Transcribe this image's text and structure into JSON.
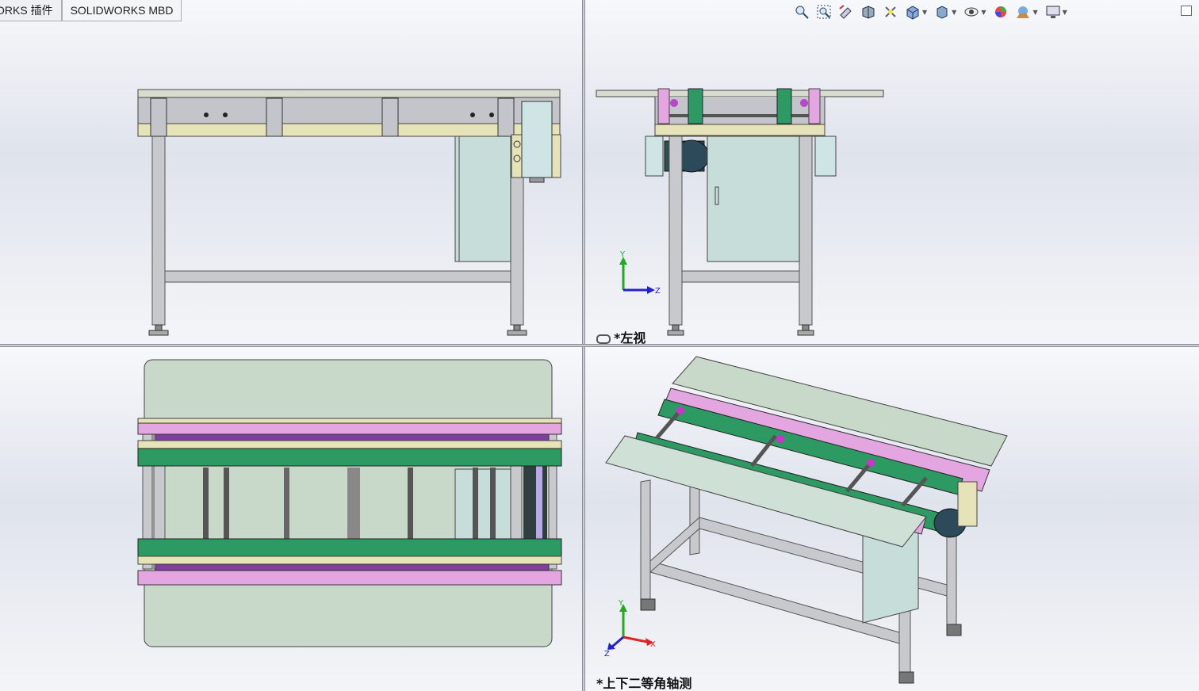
{
  "tabs": [
    {
      "label": "ORKS 插件"
    },
    {
      "label": "SOLIDWORKS MBD"
    }
  ],
  "toolbar": {
    "icons": [
      "zoom-to-fit-icon",
      "zoom-to-area-icon",
      "previous-view-icon",
      "section-view-icon",
      "dynamic-annotation-icon",
      "view-orientation-icon",
      "display-style-icon",
      "hide-show-items-icon",
      "edit-appearance-icon",
      "apply-scene-icon",
      "view-settings-icon"
    ]
  },
  "viewports": {
    "top_right": {
      "label": "*左视",
      "triad": {
        "y": "Y",
        "z": "Z"
      }
    },
    "bottom_right": {
      "label": "*上下二等角轴测",
      "triad": {
        "y": "Y",
        "x": "X",
        "z": "Z"
      }
    }
  },
  "colors": {
    "steel": "#c8c9cc",
    "steel_dark": "#8e9095",
    "belt_pink": "#e3a6e0",
    "belt_green": "#2e9a63",
    "panel_beige": "#e7e3b8",
    "cabinet": "#c7ddd9",
    "table_top": "#c9d9c9",
    "axis_x": "#d22",
    "axis_y": "#2a2",
    "axis_z": "#22c"
  }
}
